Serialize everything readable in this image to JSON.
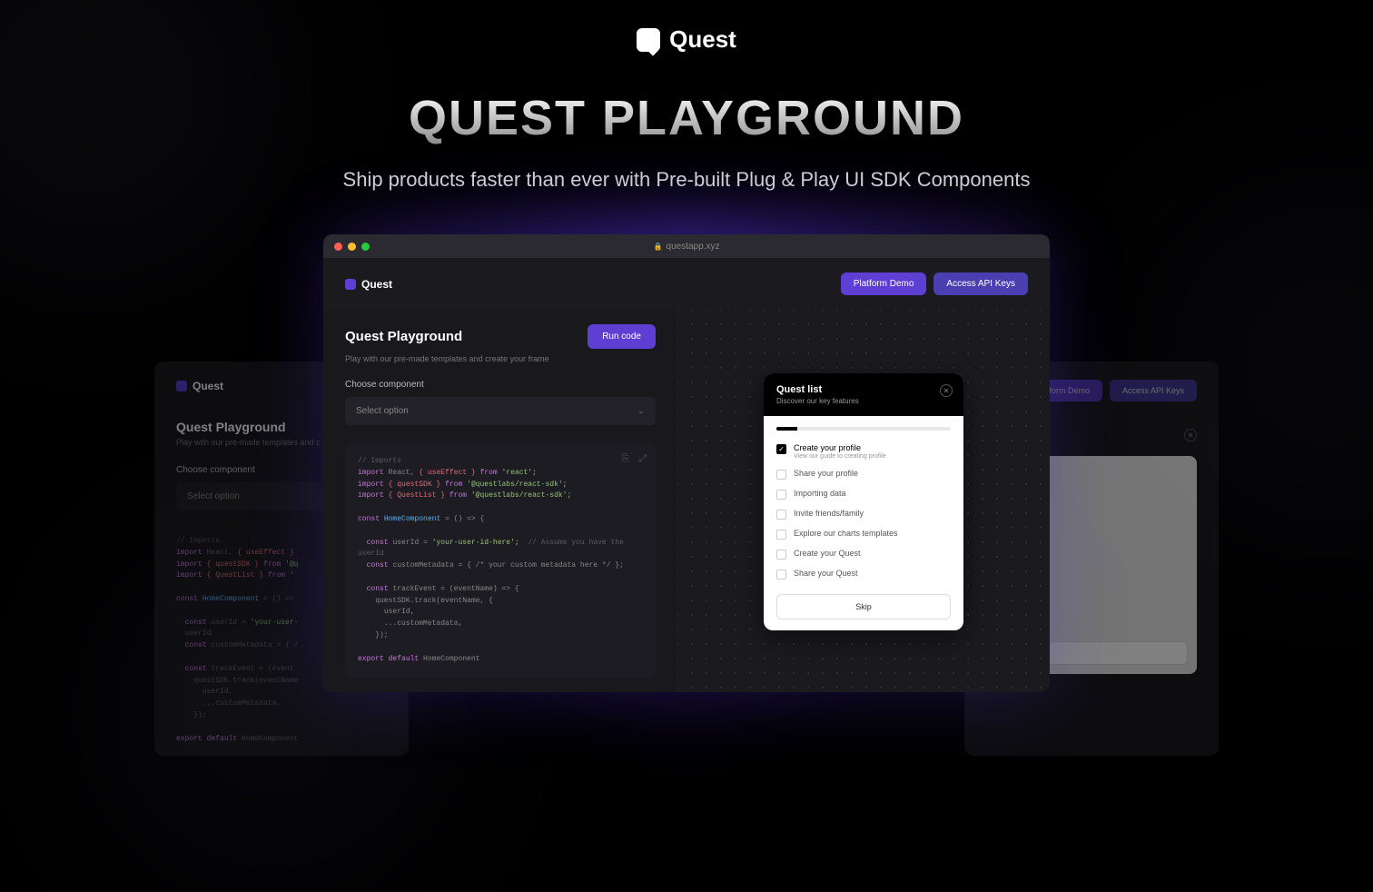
{
  "hero": {
    "brand": "Quest",
    "title": "QUEST PLAYGROUND",
    "subtitle": "Ship products faster than ever with Pre-built Plug & Play UI SDK Components"
  },
  "browser": {
    "url": "questapp.xyz"
  },
  "header": {
    "brand": "Quest",
    "platform_demo": "Platform Demo",
    "access_api": "Access API Keys"
  },
  "panel": {
    "title": "Quest Playground",
    "subtitle": "Play with our pre-made templates and create your frame",
    "run_label": "Run code",
    "choose_label": "Choose component",
    "select_placeholder": "Select option"
  },
  "code": {
    "comment_header": "// Imports",
    "l1a": "import",
    "l1b": "React,",
    "l1c": "{ useEffect }",
    "l1d": "from",
    "l1e": "'react';",
    "l2a": "import",
    "l2b": "{ questSDK }",
    "l2c": "from",
    "l2d": "'@questlabs/react-sdk';",
    "l3a": "import",
    "l3b": "{ QuestList }",
    "l3c": "from",
    "l3d": "'@questlabs/react-sdk';",
    "l4a": "const",
    "l4b": "HomeComponent",
    "l4c": "= () => {",
    "l5a": "const",
    "l5b": "userId",
    "l5c": "=",
    "l5d": "'your-user-id-here';",
    "l5e": "// Assume you have the userId",
    "l6a": "const",
    "l6b": "customMetadata",
    "l6c": "= { /* your custom metadata here */ };",
    "l7a": "const",
    "l7b": "trackEvent",
    "l7c": "= (eventName) => {",
    "l8": "questSDK.track(eventName, {",
    "l9": "userId,",
    "l10": "...customMetadata,",
    "l11": "});",
    "l12a": "export",
    "l12b": "default",
    "l12c": "HomeComponent"
  },
  "card": {
    "title": "Quest list",
    "subtitle": "Discover our key features",
    "items": [
      {
        "label": "Create your profile",
        "desc": "View our guide to creating profile",
        "checked": true
      },
      {
        "label": "Share your profile",
        "checked": false
      },
      {
        "label": "Importing data",
        "checked": false
      },
      {
        "label": "Invite friends/family",
        "checked": false
      },
      {
        "label": "Explore our charts templates",
        "checked": false
      },
      {
        "label": "Create your Quest",
        "checked": false
      },
      {
        "label": "Share your Quest",
        "checked": false
      }
    ],
    "skip_label": "Skip"
  }
}
